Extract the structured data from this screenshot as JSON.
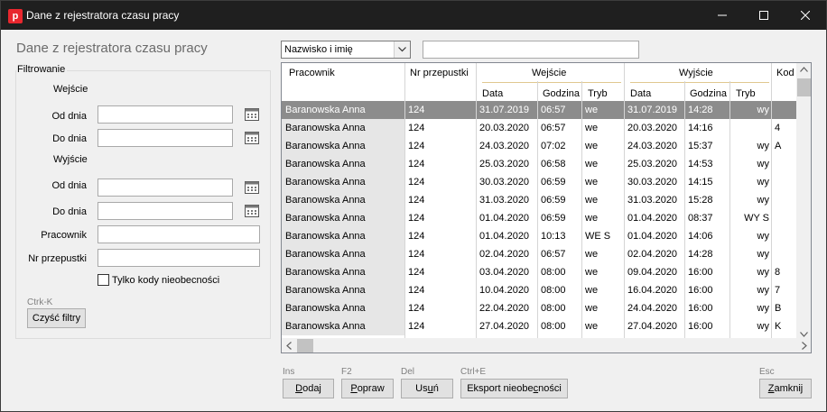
{
  "window": {
    "title": "Dane z rejestratora czasu pracy",
    "app_icon_letter": "p"
  },
  "heading": "Dane z rejestratora czasu pracy",
  "filter": {
    "group_label": "Filtrowanie",
    "entry_section": "Wejście",
    "exit_section": "Wyjście",
    "from_label": "Od dnia",
    "to_label": "Do dnia",
    "employee_label": "Pracownik",
    "pass_label": "Nr przepustki",
    "absence_only_label": "Tylko kody nieobecności",
    "clear_shortcut": "Ctrk-K",
    "clear_button": "Czyść filtry"
  },
  "search": {
    "field_selected": "Nazwisko i imię",
    "value": ""
  },
  "grid": {
    "headers": {
      "employee": "Pracownik",
      "pass": "Nr przepustki",
      "entry": "Wejście",
      "exit": "Wyjście",
      "code": "Kod",
      "date": "Data",
      "time": "Godzina",
      "mode": "Tryb"
    },
    "rows": [
      {
        "name": "Baranowska Anna",
        "pass": "124",
        "in_date": "31.07.2019",
        "in_time": "06:57",
        "in_mode": "we",
        "out_date": "31.07.2019",
        "out_time": "14:28",
        "out_mode": "wy",
        "code": "",
        "selected": true
      },
      {
        "name": "Baranowska Anna",
        "pass": "124",
        "in_date": "20.03.2020",
        "in_time": "06:57",
        "in_mode": "we",
        "out_date": "20.03.2020",
        "out_time": "14:16",
        "out_mode": "",
        "code": "4"
      },
      {
        "name": "Baranowska Anna",
        "pass": "124",
        "in_date": "24.03.2020",
        "in_time": "07:02",
        "in_mode": "we",
        "out_date": "24.03.2020",
        "out_time": "15:37",
        "out_mode": "wy",
        "code": "A"
      },
      {
        "name": "Baranowska Anna",
        "pass": "124",
        "in_date": "25.03.2020",
        "in_time": "06:58",
        "in_mode": "we",
        "out_date": "25.03.2020",
        "out_time": "14:53",
        "out_mode": "wy",
        "code": ""
      },
      {
        "name": "Baranowska Anna",
        "pass": "124",
        "in_date": "30.03.2020",
        "in_time": "06:59",
        "in_mode": "we",
        "out_date": "30.03.2020",
        "out_time": "14:15",
        "out_mode": "wy",
        "code": ""
      },
      {
        "name": "Baranowska Anna",
        "pass": "124",
        "in_date": "31.03.2020",
        "in_time": "06:59",
        "in_mode": "we",
        "out_date": "31.03.2020",
        "out_time": "15:28",
        "out_mode": "wy",
        "code": ""
      },
      {
        "name": "Baranowska Anna",
        "pass": "124",
        "in_date": "01.04.2020",
        "in_time": "06:59",
        "in_mode": "we",
        "out_date": "01.04.2020",
        "out_time": "08:37",
        "out_mode": "WY S",
        "code": ""
      },
      {
        "name": "Baranowska Anna",
        "pass": "124",
        "in_date": "01.04.2020",
        "in_time": "10:13",
        "in_mode": "WE S",
        "out_date": "01.04.2020",
        "out_time": "14:06",
        "out_mode": "wy",
        "code": ""
      },
      {
        "name": "Baranowska Anna",
        "pass": "124",
        "in_date": "02.04.2020",
        "in_time": "06:57",
        "in_mode": "we",
        "out_date": "02.04.2020",
        "out_time": "14:28",
        "out_mode": "wy",
        "code": ""
      },
      {
        "name": "Baranowska Anna",
        "pass": "124",
        "in_date": "03.04.2020",
        "in_time": "08:00",
        "in_mode": "we",
        "out_date": "09.04.2020",
        "out_time": "16:00",
        "out_mode": "wy",
        "code": "8"
      },
      {
        "name": "Baranowska Anna",
        "pass": "124",
        "in_date": "10.04.2020",
        "in_time": "08:00",
        "in_mode": "we",
        "out_date": "16.04.2020",
        "out_time": "16:00",
        "out_mode": "wy",
        "code": "7"
      },
      {
        "name": "Baranowska Anna",
        "pass": "124",
        "in_date": "22.04.2020",
        "in_time": "08:00",
        "in_mode": "we",
        "out_date": "24.04.2020",
        "out_time": "16:00",
        "out_mode": "wy",
        "code": "B"
      },
      {
        "name": "Baranowska Anna",
        "pass": "124",
        "in_date": "27.04.2020",
        "in_time": "08:00",
        "in_mode": "we",
        "out_date": "27.04.2020",
        "out_time": "16:00",
        "out_mode": "wy",
        "code": "K"
      }
    ]
  },
  "actions": {
    "add": {
      "shortcut": "Ins",
      "label_ul": "D",
      "label_rest": "odaj"
    },
    "edit": {
      "shortcut": "F2",
      "label_ul": "P",
      "label_rest": "opraw"
    },
    "delete": {
      "shortcut": "Del",
      "label_pre": "Us",
      "label_ul": "u",
      "label_rest": "ń"
    },
    "export": {
      "shortcut": "Ctrl+E",
      "label_pre": "Eksport nieobe",
      "label_ul": "c",
      "label_rest": "ności"
    },
    "close": {
      "shortcut": "Esc",
      "label_ul": "Z",
      "label_rest": "amknij"
    }
  }
}
